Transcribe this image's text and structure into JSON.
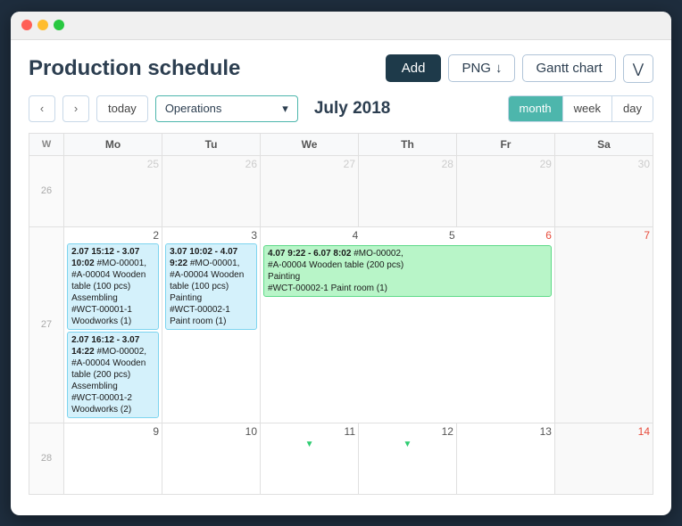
{
  "app": {
    "title": "Production schedule",
    "window_controls": [
      "red",
      "yellow",
      "green"
    ]
  },
  "header": {
    "title": "Production schedule",
    "add_label": "Add",
    "png_label": "PNG",
    "gantt_label": "Gantt chart",
    "more_label": "⋁"
  },
  "toolbar": {
    "prev_label": "‹",
    "next_label": "›",
    "today_label": "today",
    "operations_label": "Operations",
    "month_label": "July 2018",
    "view_month": "month",
    "view_week": "week",
    "view_day": "day"
  },
  "calendar": {
    "headers": [
      "W",
      "Mo",
      "Tu",
      "We",
      "Th",
      "Fr",
      "Sa"
    ],
    "rows": [
      {
        "week": "26",
        "days": [
          {
            "num": "25",
            "type": "other-month"
          },
          {
            "num": "26",
            "type": "other-month"
          },
          {
            "num": "27",
            "type": "other-month"
          },
          {
            "num": "28",
            "type": "other-month"
          },
          {
            "num": "29",
            "type": "other-month"
          },
          {
            "num": "30",
            "type": "saturday other-month"
          }
        ]
      },
      {
        "week": "27",
        "days": [
          {
            "num": "2",
            "type": "normal"
          },
          {
            "num": "3",
            "type": "normal"
          },
          {
            "num": "4",
            "type": "normal"
          },
          {
            "num": "5",
            "type": "normal"
          },
          {
            "num": "6",
            "type": "normal"
          },
          {
            "num": "7",
            "type": "saturday"
          }
        ],
        "events_mo": [
          {
            "color": "blue",
            "text": "2.07 15:12 - 3.07 10:02 #MO-00001,\n#A-00004 Wooden table (100 pcs)\nAssembling\n#WCT-00001-1 Woodworks (1)"
          },
          {
            "color": "blue",
            "text": "2.07 16:12 - 3.07 14:22 #MO-00002,\n#A-00004 Wooden table (200 pcs)\nAssembling\n#WCT-00001-2 Woodworks (2)"
          }
        ],
        "events_tu": [
          {
            "color": "blue",
            "text": "3.07 10:02 - 4.07 9:22 #MO-00001,\n#A-00004 Wooden table (100 pcs)\nPainting\n#WCT-00002-1 Paint room (1)"
          }
        ],
        "events_we": [
          {
            "color": "green",
            "text": "4.07 9:22 - 6.07 8:02 #MO-00002,\n#A-00004 Wooden table (200 pcs)\nPainting\n#WCT-00002-1 Paint room (1)"
          }
        ]
      },
      {
        "week": "28",
        "days": [
          {
            "num": "9",
            "type": "normal"
          },
          {
            "num": "10",
            "type": "normal"
          },
          {
            "num": "11",
            "type": "normal"
          },
          {
            "num": "12",
            "type": "normal"
          },
          {
            "num": "13",
            "type": "normal"
          },
          {
            "num": "14",
            "type": "saturday"
          }
        ]
      }
    ]
  }
}
